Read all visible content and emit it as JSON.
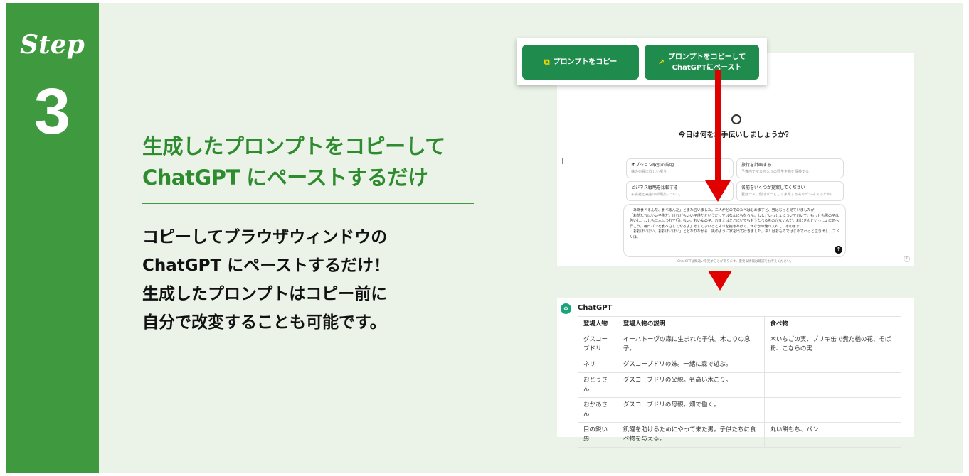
{
  "step": {
    "word": "Step",
    "number": "3"
  },
  "heading": {
    "line1": "生成したプロンプトをコピーして",
    "line2": "ChatGPT にペーストするだけ"
  },
  "body": {
    "line1": "コピーしてブラウザウィンドウの",
    "line2": "ChatGPT にペーストするだけ！",
    "line3": "生成したプロンプトはコピー前に",
    "line4": "自分で改変することも可能です。"
  },
  "buttons": {
    "copy_label": "プロンプトをコピー",
    "paste_label": "プロンプトをコピーして\nChatGPTにペースト",
    "copy_icon": "copy-icon",
    "paste_icon": "external-link-icon",
    "color": "#1f8b4c",
    "icon_color": "#f5d800"
  },
  "chat": {
    "greeting": "今日は何をお手伝いしましょうか？",
    "suggestions": [
      {
        "title": "オプション取引の説明",
        "subtitle": "株の売買に詳しい場合"
      },
      {
        "title": "旅行を計画する",
        "subtitle": "予算内でマカオ入りの野生生物を探検する"
      },
      {
        "title": "ビジネス戦略を比較する",
        "subtitle": "子会社と実店の新規案について"
      },
      {
        "title": "名前をいくつか提案してください",
        "subtitle": "夏はラス、例ばパーとして家業するものビジネスのために"
      }
    ],
    "prompt_text": "「ああ食べるんだ、食べるんだ」とまた言いました。二人がどのでのたべはじめますと、男はじっと見ていましたが、\n「お前たちはいい子供だ。けれどもいい子供だというだけではなんにもならん。わしといっしょについておいで。もっとも男の子は強いし、わしも二人はつれて行けない。おい女の子、おまえはここにいてももうたべるものがないんだ。おじさんといっしょに町へ行こう。毎日パンを食べさしてやるよ」そしてぷいっとネリを抱きあげて、せなかの籠へ入れて、そのまま、\n「おおほいほい、おおほいほい」とどなりながら、風のように家を出て行きました。ネリはおもてではじめてわっと泣き出し、ブドリは、",
    "disclaimer": "ChatGPTは間違いを犯すことがあります。重要な情報は確認をお考えください。",
    "help": "?"
  },
  "result": {
    "name": "ChatGPT",
    "headers": [
      "登場人物",
      "登場人物の説明",
      "食べ物"
    ],
    "rows": [
      [
        "グスコーブドリ",
        "イーハトーヴの森に生まれた子供。木こりの息子。",
        "木いちごの実、ブリキ缶で煮た楢の花、そば粉、こならの実"
      ],
      [
        "ネリ",
        "グスコーブドリの妹。一緒に森で遊ぶ。",
        ""
      ],
      [
        "おとうさん",
        "グスコーブドリの父親。名高い木こり。",
        ""
      ],
      [
        "おかあさん",
        "グスコーブドリの母親。畑で働く。",
        ""
      ],
      [
        "目の鋭い男",
        "飢饉を助けるためにやって来た男。子供たちに食べ物を与える。",
        "丸い餅もち、パン"
      ]
    ]
  },
  "colors": {
    "step_green": "#3f9a3f",
    "heading_green": "#2e8b2e",
    "background": "#ebf3e9",
    "arrow_red": "#e00000"
  }
}
